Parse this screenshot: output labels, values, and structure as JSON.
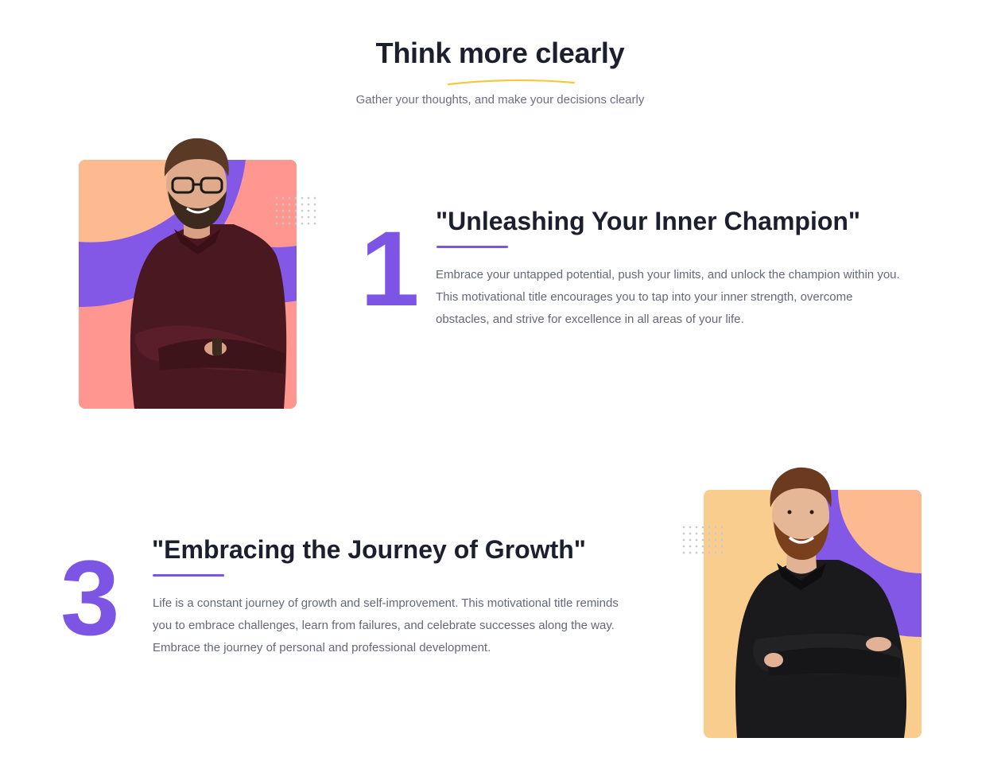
{
  "header": {
    "title": "Think more clearly",
    "subtitle": "Gather your thoughts, and make your decisions clearly"
  },
  "features": [
    {
      "number": "1",
      "title": "\"Unleashing Your Inner Champion\"",
      "description": "Embrace your untapped potential, push your limits, and unlock the champion within you. This motivational title encourages you to tap into your inner strength, overcome obstacles, and strive for excellence in all areas of your life.",
      "image": "portrait-man-glasses-maroon-shirt",
      "card_colors": {
        "base": "#ff9690",
        "blob_top": "#fdb990",
        "arc": "#8458e6"
      }
    },
    {
      "number": "3",
      "title": "\"Embracing the Journey of Growth\"",
      "description": "Life is a constant journey of growth and self-improvement. This motivational title reminds you to embrace challenges, learn from failures, and celebrate successes along the way. Embrace the journey of personal and professional development.",
      "image": "portrait-man-beard-black-shirt",
      "card_colors": {
        "base": "#f8cd8e",
        "blob_top": "#fdb990",
        "arc": "#8458e6"
      }
    }
  ],
  "colors": {
    "accent": "#7c55e4",
    "heading": "#1b1f2e",
    "body_text": "#646878",
    "underline_gold": "#f5c842"
  }
}
